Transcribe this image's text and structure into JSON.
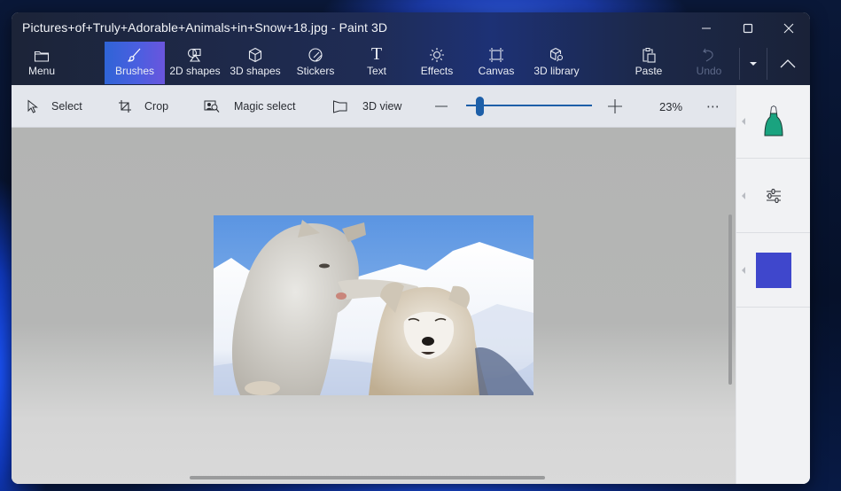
{
  "window": {
    "title": "Pictures+of+Truly+Adorable+Animals+in+Snow+18.jpg - Paint 3D",
    "controls": {
      "minimize": "minimize-icon",
      "maximize": "maximize-icon",
      "close": "close-icon"
    }
  },
  "ribbon": {
    "menu": {
      "label": "Menu",
      "icon": "folder-icon"
    },
    "items": [
      {
        "label": "Brushes",
        "icon": "brush-icon",
        "active": true
      },
      {
        "label": "2D shapes",
        "icon": "2d-shapes-icon"
      },
      {
        "label": "3D shapes",
        "icon": "cube-icon"
      },
      {
        "label": "Stickers",
        "icon": "sticker-icon"
      },
      {
        "label": "Text",
        "icon": "text-icon",
        "glyph": "T"
      },
      {
        "label": "Effects",
        "icon": "sun-icon"
      },
      {
        "label": "Canvas",
        "icon": "canvas-icon"
      },
      {
        "label": "3D library",
        "icon": "3d-library-icon"
      }
    ],
    "paste": {
      "label": "Paste",
      "icon": "clipboard-icon"
    },
    "undo": {
      "label": "Undo",
      "icon": "undo-icon",
      "disabled": true
    },
    "history_dropdown": {
      "icon": "caret-down-icon"
    },
    "collapse": {
      "icon": "chevron-up-icon"
    }
  },
  "toolbar": {
    "select": {
      "label": "Select",
      "icon": "cursor-icon"
    },
    "crop": {
      "label": "Crop",
      "icon": "crop-icon"
    },
    "magic_select": {
      "label": "Magic select",
      "icon": "magic-select-icon"
    },
    "view_3d": {
      "label": "3D view",
      "icon": "3d-view-icon"
    },
    "zoom": {
      "out_icon": "minus-icon",
      "in_icon": "plus-icon",
      "slider_fraction": 0.08,
      "value_text": "23%"
    },
    "more": {
      "label": "⋯",
      "icon": "more-icon"
    }
  },
  "canvas": {
    "image_alt": "Two white husky puppies in the snow under a blue sky"
  },
  "side_panel": {
    "brush": {
      "icon": "marker-icon",
      "color": "#1aa37f"
    },
    "settings": {
      "icon": "sliders-icon"
    },
    "color": {
      "icon": "color-swatch",
      "value": "#3f47cc"
    }
  },
  "colors": {
    "accent_start": "#2f64d6",
    "accent_end": "#6a55dd",
    "zoom_slider": "#1d5fa8"
  }
}
